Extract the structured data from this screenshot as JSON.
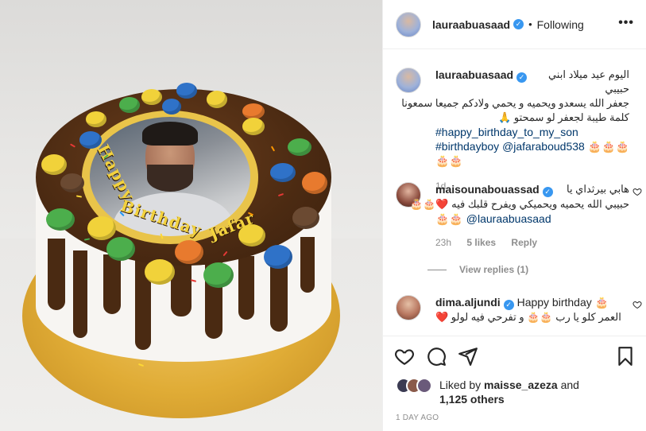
{
  "post": {
    "author": "lauraabuasaad",
    "following_label": "Following",
    "dot": "•",
    "more_label": "•••",
    "verified_mark": "✓"
  },
  "image": {
    "cake_text_1": "Happy",
    "cake_text_2": "Birthday",
    "cake_text_3": "Jafar"
  },
  "caption": {
    "username": "lauraabuasaad",
    "line1": "اليوم عيد ميلاد ابني حبيبي",
    "line2": "جعفر الله يسعدو ويحميه و يحمي ولادكم جميعا سمعونا",
    "line3": "كلمة طيبة لجعفر لو سمحتو 🙏",
    "hashtag1": "#happy_birthday_to_my_son",
    "hashtag2": "#birthdayboy",
    "mention": "@jafaraboud538",
    "emojis": "🎂🎂🎂🎂🎂",
    "age": "1d"
  },
  "comment1": {
    "username": "maisounabouassad",
    "line1": "هابي بيرثداي يا",
    "line2": "حبيبي الله يحميه ويحميكي ويفرح قلبك فيه ❤️🎂🎂",
    "line3_emoji": "🎂🎂",
    "mention": "@lauraabuasaad",
    "age": "23h",
    "likes": "5 likes",
    "reply": "Reply",
    "view_replies": "View replies (1)"
  },
  "comment2": {
    "username": "dima.aljundi",
    "line1": "Happy birthday 🎂",
    "line2": "العمر كلو يا رب 🎂🎂 و تفرحي فيه لولو ❤️"
  },
  "likes": {
    "prefix": "Liked by",
    "user": "maisse_azeza",
    "and": "and",
    "others": "1,125 others"
  },
  "timestamp": "1 DAY AGO",
  "colors": {
    "link": "#00376b",
    "verified": "#3897f0",
    "muted": "#8e8e8e"
  }
}
